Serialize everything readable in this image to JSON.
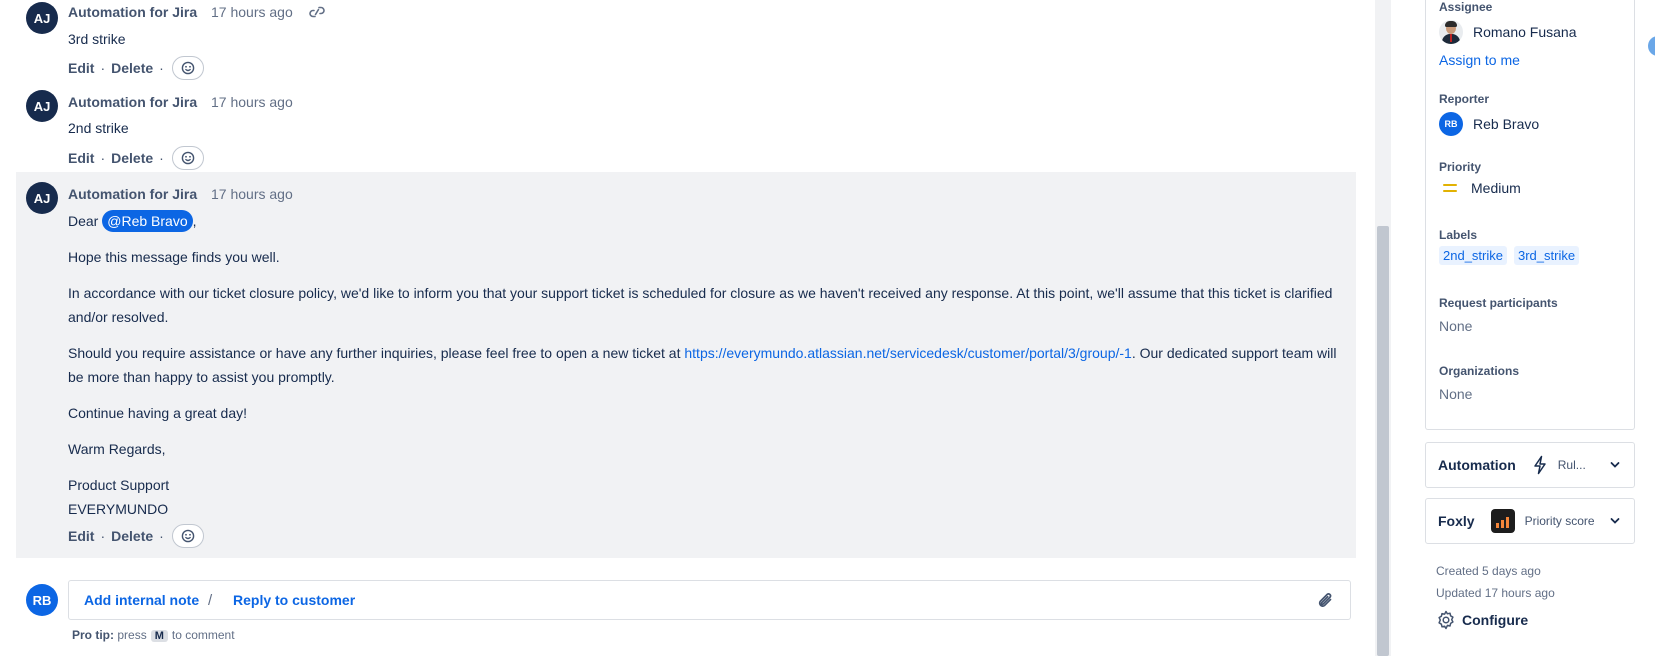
{
  "comments": [
    {
      "avatar": "AJ",
      "author": "Automation for Jira",
      "time": "17 hours ago",
      "text": "3rd strike",
      "actions": {
        "edit": "Edit",
        "delete": "Delete",
        "sep": "·"
      }
    },
    {
      "avatar": "AJ",
      "author": "Automation for Jira",
      "time": "17 hours ago",
      "text": "2nd strike",
      "actions": {
        "edit": "Edit",
        "delete": "Delete",
        "sep": "·"
      }
    },
    {
      "avatar": "AJ",
      "author": "Automation for Jira",
      "time": "17 hours ago",
      "greeting": "Dear",
      "mention": "@Reb Bravo",
      "greeting_end": ",",
      "p1": "Hope this message finds you well.",
      "p2": "In accordance with our ticket closure policy, we'd like to inform you that your support ticket is scheduled for closure as we haven't received any response. At this point, we'll assume that this ticket is clarified and/or resolved.",
      "p3_before": "Should you require assistance or have any further inquiries, please feel free to open a new ticket at",
      "p3_link": "https://everymundo.atlassian.net/servicedesk/customer/portal/3/group/-1",
      "p3_after": ". Our dedicated support team will be more than happy to assist you promptly.",
      "p4": "Continue having a great day!",
      "p5": "Warm Regards,",
      "sig1": "Product Support",
      "sig2": "EVERYMUNDO",
      "actions": {
        "edit": "Edit",
        "delete": "Delete",
        "sep": "·"
      }
    }
  ],
  "reply": {
    "avatar": "RB",
    "internal_note": "Add internal note",
    "separator": "/",
    "reply_customer": "Reply to customer"
  },
  "pro_tip": {
    "label": "Pro tip:",
    "press": "press",
    "key": "M",
    "suffix": "to comment"
  },
  "details": {
    "assignee_label": "Assignee",
    "assignee_name": "Romano Fusana",
    "assign_to_me": "Assign to me",
    "reporter_label": "Reporter",
    "reporter_initials": "RB",
    "reporter_name": "Reb Bravo",
    "priority_label": "Priority",
    "priority_value": "Medium",
    "priority_color": "#e2b203",
    "labels_label": "Labels",
    "labels": [
      "2nd_strike",
      "3rd_strike"
    ],
    "request_participants_label": "Request participants",
    "request_participants_value": "None",
    "organizations_label": "Organizations",
    "organizations_value": "None"
  },
  "panels": {
    "automation_title": "Automation",
    "automation_sub": "Rul...",
    "foxly_title": "Foxly",
    "foxly_sub": "Priority score"
  },
  "meta": {
    "created": "Created 5 days ago",
    "updated": "Updated 17 hours ago",
    "configure": "Configure"
  },
  "colors": {
    "primary": "#0c66e4",
    "text": "#172b4d",
    "avatar_dark": "#172b4d",
    "highlight_bg": "#f1f2f4"
  }
}
